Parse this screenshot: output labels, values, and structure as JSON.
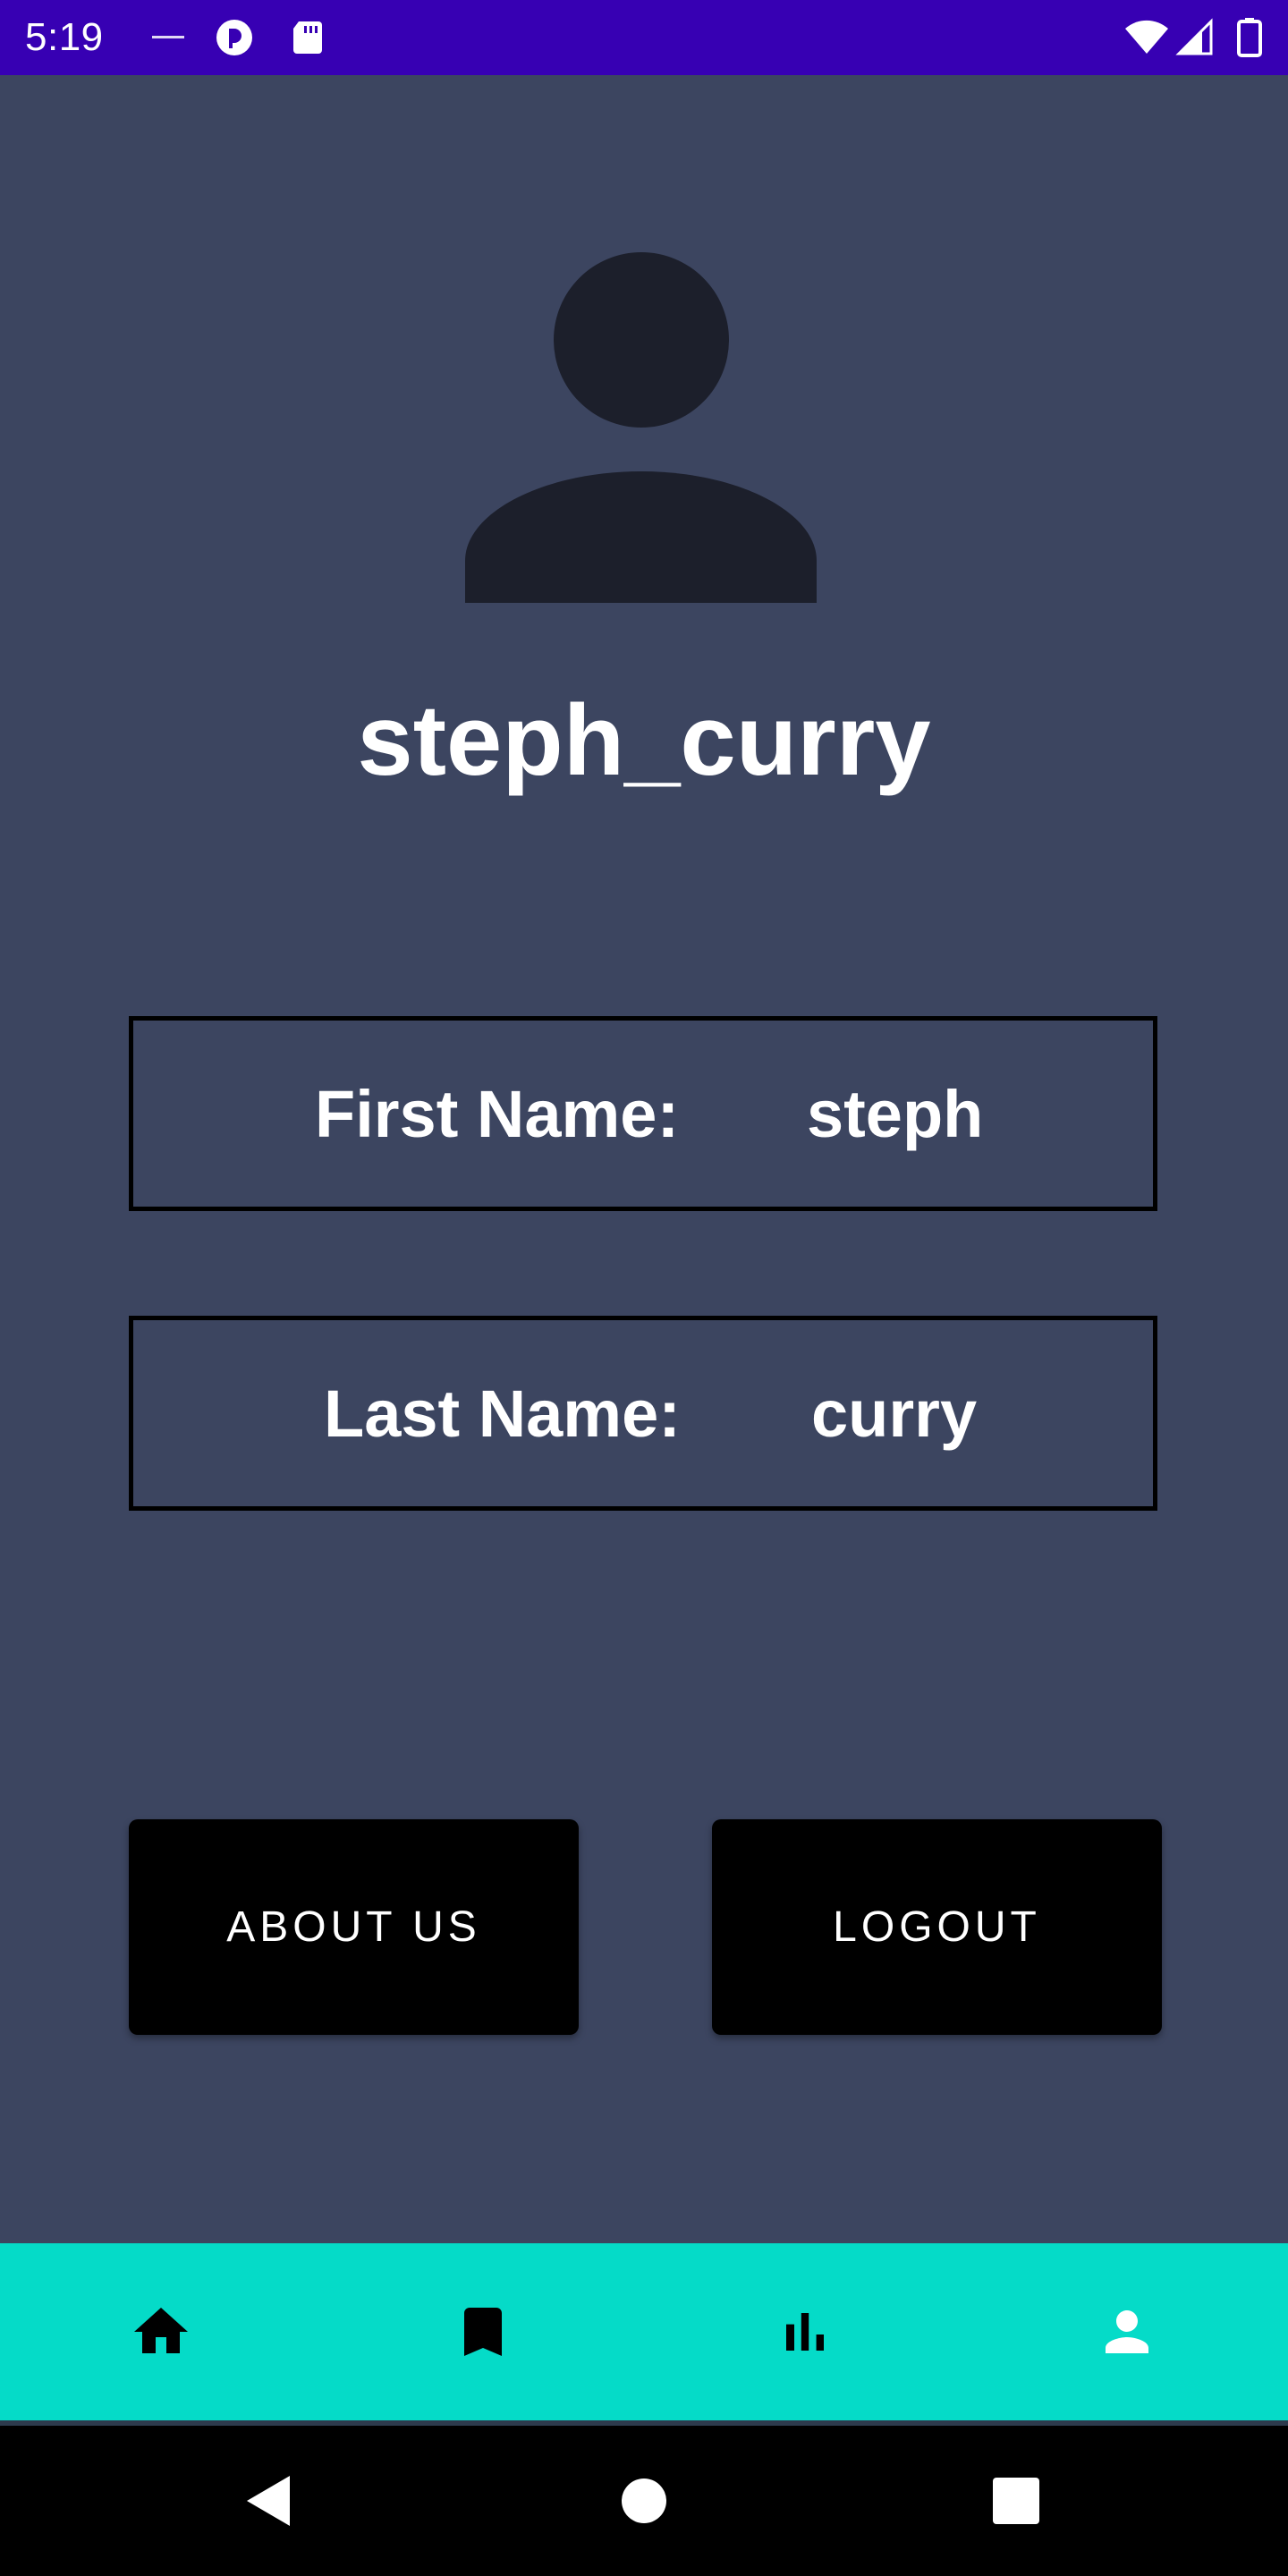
{
  "status_bar": {
    "time": "5:19"
  },
  "profile": {
    "username": "steph_curry",
    "first_name_label": "First Name:",
    "first_name_value": "steph",
    "last_name_label": "Last Name:",
    "last_name_value": "curry"
  },
  "actions": {
    "about_label": "ABOUT US",
    "logout_label": "LOGOUT"
  },
  "bottom_nav": {
    "items": [
      {
        "icon": "home-icon"
      },
      {
        "icon": "bookmark-icon"
      },
      {
        "icon": "bar-chart-icon"
      },
      {
        "icon": "person-icon",
        "selected": true
      }
    ]
  },
  "colors": {
    "status_bar": "#3700b3",
    "background": "#3c4560",
    "avatar": "#1c1f2b",
    "bottom_nav": "#05dbc8",
    "button": "#000000",
    "text": "#ffffff"
  }
}
